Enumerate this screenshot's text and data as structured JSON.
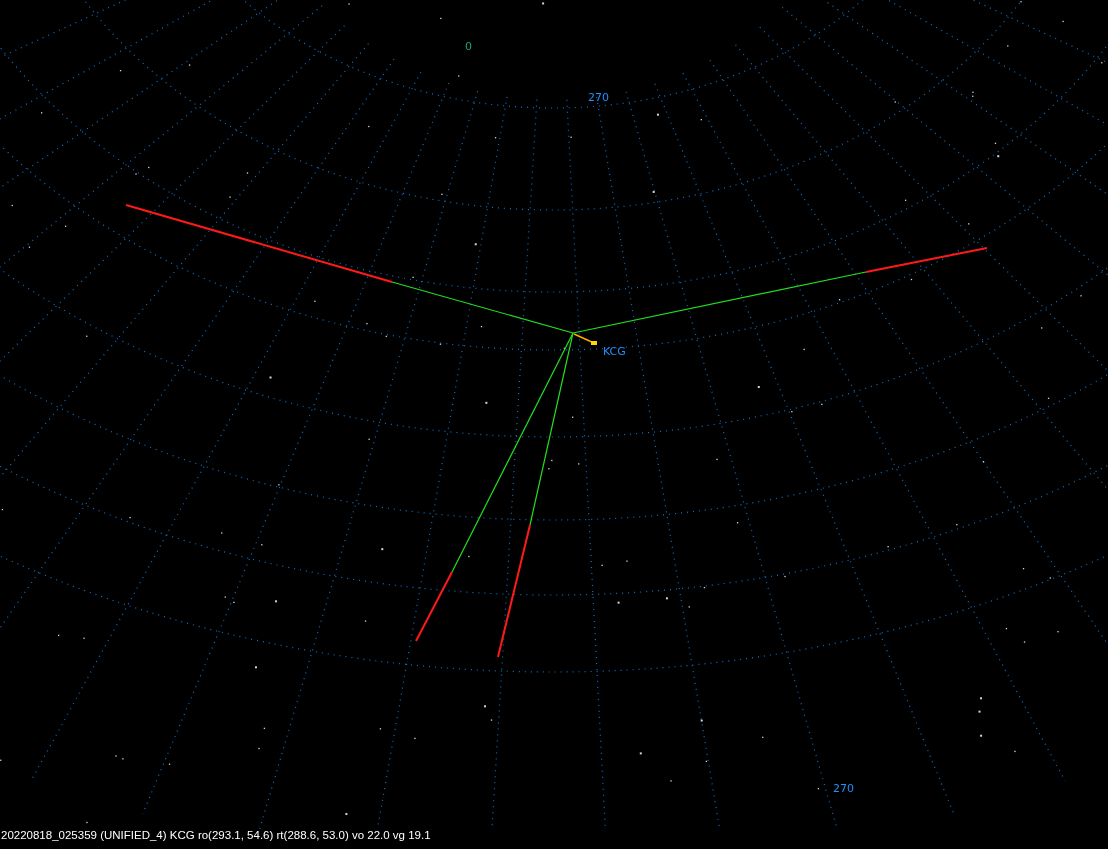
{
  "grid_labels": [
    {
      "text": "0",
      "color": "#1aa07a"
    },
    {
      "text": "270",
      "color": "#1e90ff"
    },
    {
      "text": "270",
      "color": "#1e90ff"
    }
  ],
  "shower_label": "KCG",
  "status_bar": "20220818_025359 (UNIFIED_4) KCG ro(293.1, 54.6) rt(288.6, 53.0) vo 22.0 vg 19.1"
}
